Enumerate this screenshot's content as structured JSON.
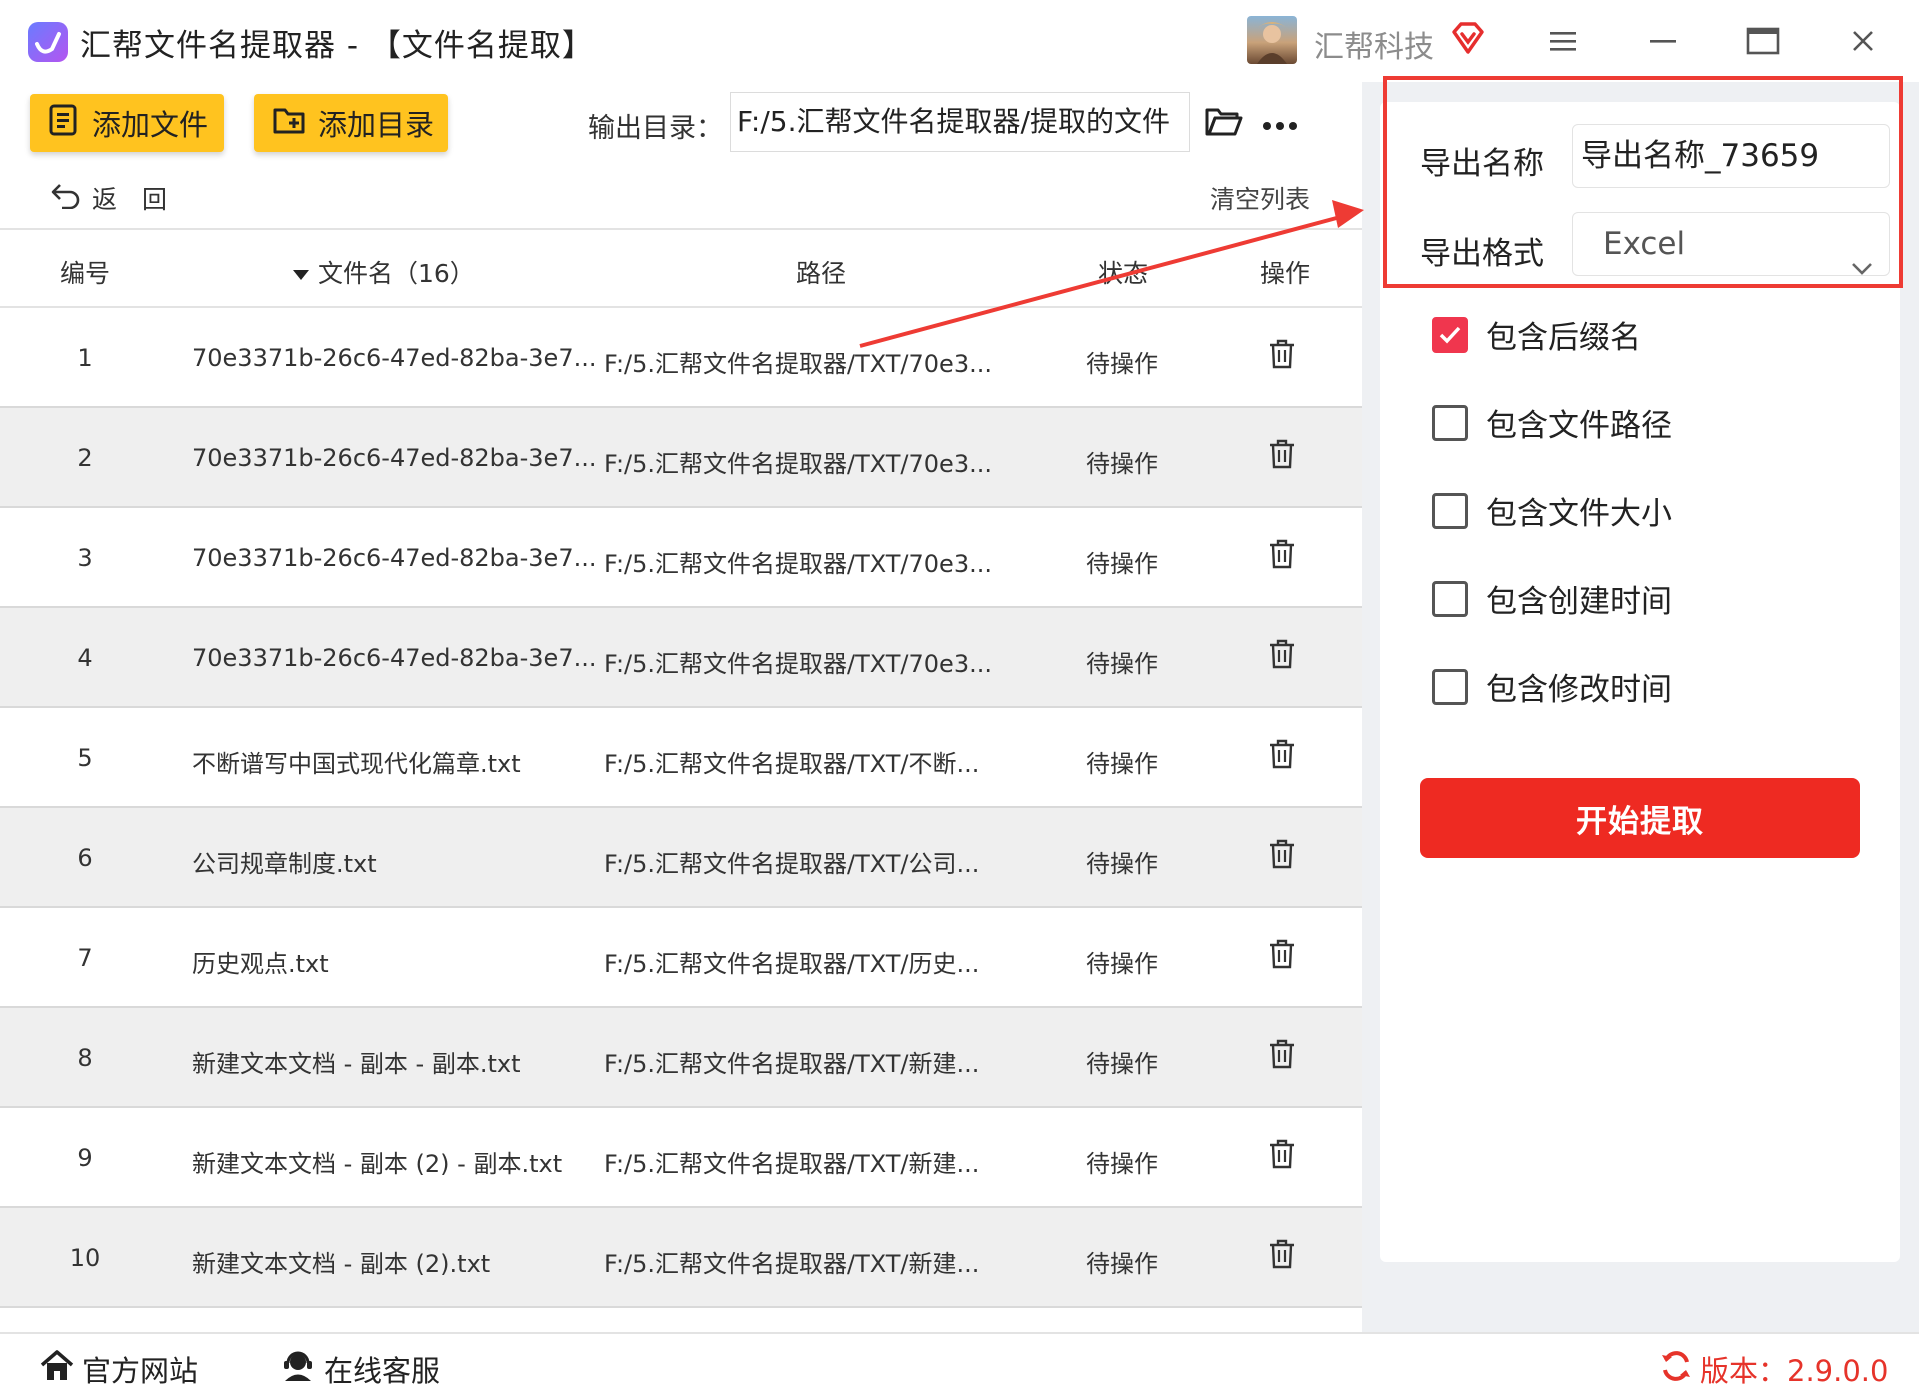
{
  "window": {
    "title": "汇帮文件名提取器 - 【文件名提取】",
    "brand": "汇帮科技"
  },
  "toolbar": {
    "add_file": "添加文件",
    "add_dir": "添加目录",
    "output_label": "输出目录：",
    "output_value": "F:/5.汇帮文件名提取器/提取的文件",
    "back": "返　回",
    "clear_list": "清空列表"
  },
  "table": {
    "headers": {
      "num": "编号",
      "name": "文件名（16）",
      "path": "路径",
      "status": "状态",
      "op": "操作"
    },
    "rows": [
      {
        "num": "1",
        "name": "70e3371b-26c6-47ed-82ba-3e7...",
        "path": "F:/5.汇帮文件名提取器/TXT/70e3...",
        "status": "待操作"
      },
      {
        "num": "2",
        "name": "70e3371b-26c6-47ed-82ba-3e7...",
        "path": "F:/5.汇帮文件名提取器/TXT/70e3...",
        "status": "待操作"
      },
      {
        "num": "3",
        "name": "70e3371b-26c6-47ed-82ba-3e7...",
        "path": "F:/5.汇帮文件名提取器/TXT/70e3...",
        "status": "待操作"
      },
      {
        "num": "4",
        "name": "70e3371b-26c6-47ed-82ba-3e7...",
        "path": "F:/5.汇帮文件名提取器/TXT/70e3...",
        "status": "待操作"
      },
      {
        "num": "5",
        "name": "不断谱写中国式现代化篇章.txt",
        "path": "F:/5.汇帮文件名提取器/TXT/不断...",
        "status": "待操作"
      },
      {
        "num": "6",
        "name": "公司规章制度.txt",
        "path": "F:/5.汇帮文件名提取器/TXT/公司...",
        "status": "待操作"
      },
      {
        "num": "7",
        "name": "历史观点.txt",
        "path": "F:/5.汇帮文件名提取器/TXT/历史...",
        "status": "待操作"
      },
      {
        "num": "8",
        "name": "新建文本文档 - 副本 - 副本.txt",
        "path": "F:/5.汇帮文件名提取器/TXT/新建...",
        "status": "待操作"
      },
      {
        "num": "9",
        "name": "新建文本文档 - 副本 (2) - 副本.txt",
        "path": "F:/5.汇帮文件名提取器/TXT/新建...",
        "status": "待操作"
      },
      {
        "num": "10",
        "name": "新建文本文档 - 副本 (2).txt",
        "path": "F:/5.汇帮文件名提取器/TXT/新建...",
        "status": "待操作"
      }
    ]
  },
  "settings": {
    "export_name_label": "导出名称",
    "export_name_value": "导出名称_73659",
    "export_format_label": "导出格式",
    "export_format_value": "Excel",
    "options": [
      {
        "label": "包含后缀名",
        "checked": true
      },
      {
        "label": "包含文件路径",
        "checked": false
      },
      {
        "label": "包含文件大小",
        "checked": false
      },
      {
        "label": "包含创建时间",
        "checked": false
      },
      {
        "label": "包含修改时间",
        "checked": false
      }
    ],
    "start_button": "开始提取"
  },
  "footer": {
    "website": "官方网站",
    "support": "在线客服",
    "version": "版本：2.9.0.0"
  },
  "colors": {
    "accent_yellow": "#ffc31f",
    "accent_red": "#ee2a22",
    "checkbox_checked": "#f0364e",
    "annotation_red": "#ee3b34"
  }
}
